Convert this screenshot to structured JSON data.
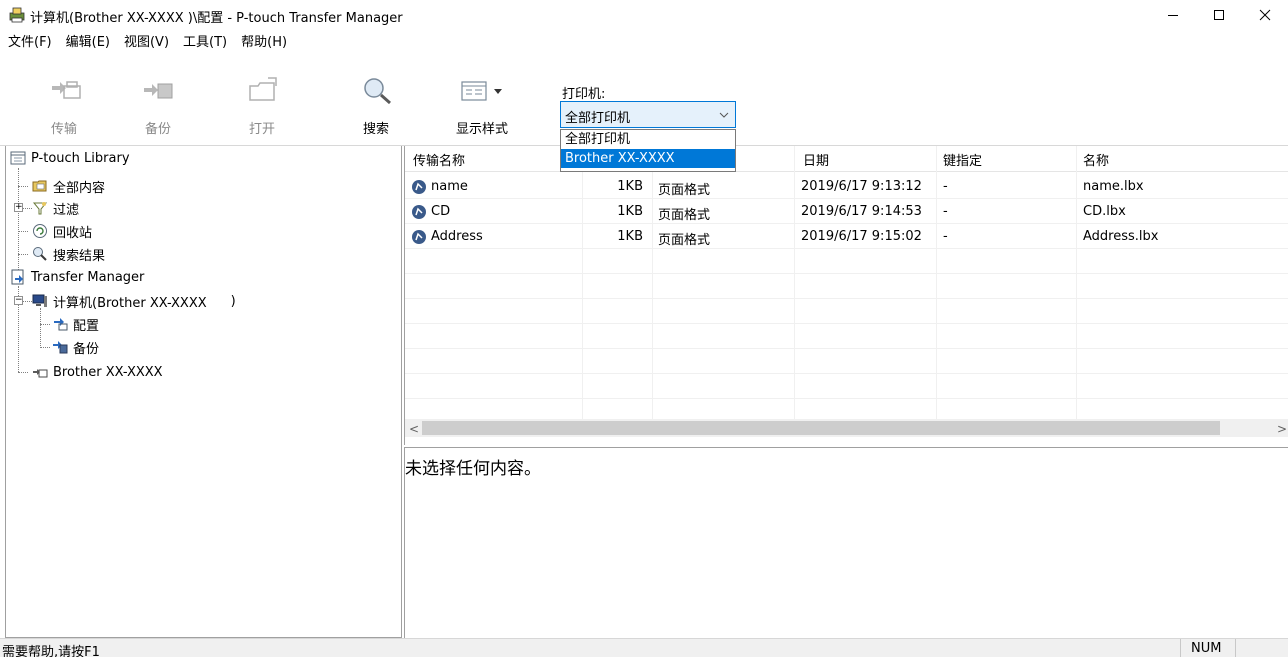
{
  "window": {
    "title": "计算机(Brother XX-XXXX )\\配置 - P-touch Transfer Manager",
    "icon": "printer-app-icon"
  },
  "menu": [
    "文件(F)",
    "编辑(E)",
    "视图(V)",
    "工具(T)",
    "帮助(H)"
  ],
  "toolbar": {
    "transfer": "传输",
    "backup": "备份",
    "open": "打开",
    "search": "搜索",
    "display_style": "显示样式",
    "printer_label": "打印机:",
    "printer_selected": "全部打印机",
    "printer_options": [
      "全部打印机",
      "Brother XX-XXXX"
    ]
  },
  "tree": {
    "library": "P-touch Library",
    "all_contents": "全部内容",
    "filter": "过滤",
    "recycle_bin": "回收站",
    "search_results": "搜索结果",
    "transfer_manager": "Transfer Manager",
    "computer": "计算机(Brother XX-XXXX",
    "computer_suffix": ")",
    "config": "配置",
    "backup": "备份",
    "printer": "Brother XX-XXXX"
  },
  "list": {
    "columns": [
      "传输名称",
      "",
      "",
      "日期",
      "键指定",
      "名称"
    ],
    "rows": [
      {
        "name": "name",
        "size": "1KB",
        "type": "页面格式",
        "date": "2019/6/17 9:13:12",
        "key": "-",
        "file": "name.lbx"
      },
      {
        "name": "CD",
        "size": "1KB",
        "type": "页面格式",
        "date": "2019/6/17 9:14:53",
        "key": "-",
        "file": "CD.lbx"
      },
      {
        "name": "Address",
        "size": "1KB",
        "type": "页面格式",
        "date": "2019/6/17 9:15:02",
        "key": "-",
        "file": "Address.lbx"
      }
    ]
  },
  "preview": {
    "text": "未选择任何内容。"
  },
  "status": {
    "help": "需要帮助,请按F1",
    "num": "NUM"
  }
}
